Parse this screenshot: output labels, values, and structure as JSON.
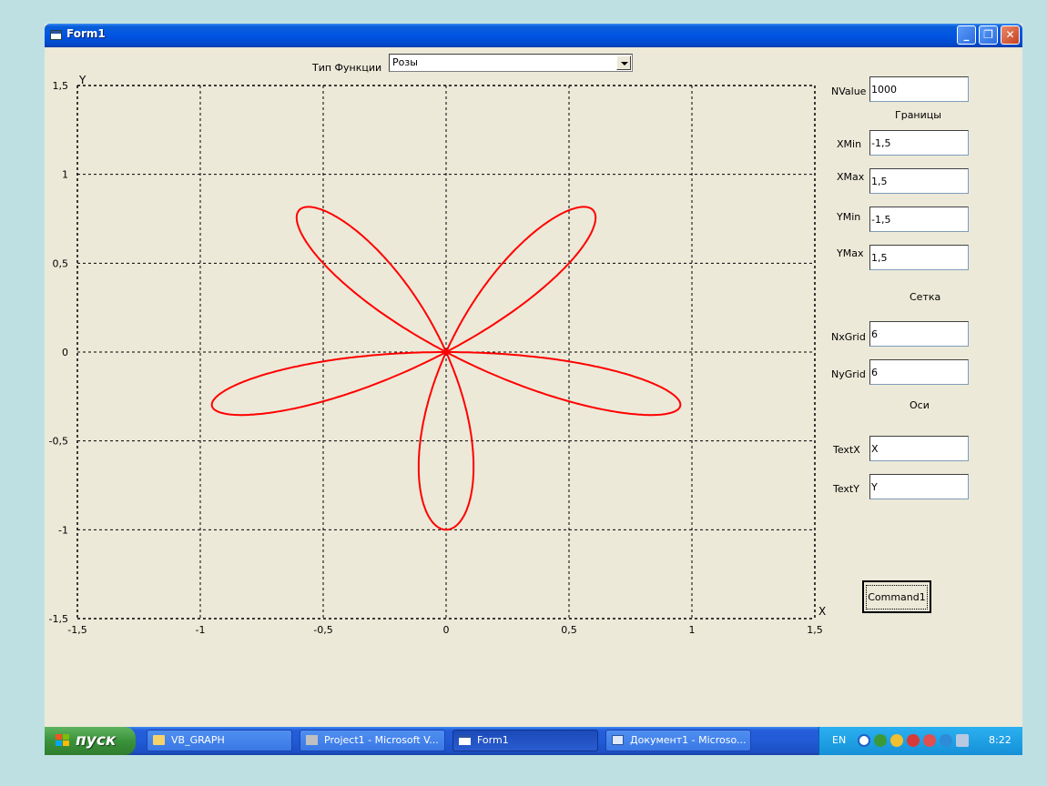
{
  "window": {
    "title": "Form1",
    "controls": {
      "minimize": "_",
      "restore": "❐",
      "close": "✕"
    }
  },
  "function_type": {
    "label": "Тип Функции",
    "value": "Розы"
  },
  "params": {
    "nvalue": {
      "label": "NValue",
      "value": "1000"
    },
    "bounds_heading": "Границы",
    "xmin": {
      "label": "XMin",
      "value": "-1,5"
    },
    "xmax": {
      "label": "XMax",
      "value": "1,5"
    },
    "ymin": {
      "label": "YMin",
      "value": "-1,5"
    },
    "ymax": {
      "label": "YMax",
      "value": "1,5"
    },
    "grid_heading": "Сетка",
    "nxgrid": {
      "label": "NxGrid",
      "value": "6"
    },
    "nygrid": {
      "label": "NyGrid",
      "value": "6"
    },
    "axes_heading": "Оси",
    "textx": {
      "label": "TextX",
      "value": "X"
    },
    "texty": {
      "label": "TextY",
      "value": "Y"
    },
    "command_label": "Command1"
  },
  "chart_data": {
    "type": "line",
    "curve": "rose",
    "equation": "r = cos(5θ)",
    "petals": 5,
    "xlim": [
      -1.5,
      1.5
    ],
    "ylim": [
      -1.5,
      1.5
    ],
    "x_ticks": [
      "-1,5",
      "-1",
      "-0,5",
      "0",
      "0,5",
      "1",
      "1,5"
    ],
    "y_ticks": [
      "1,5",
      "1",
      "0,5",
      "0",
      "-0,5",
      "-1",
      "-1,5"
    ],
    "xlabel": "X",
    "ylabel": "Y",
    "grid": true,
    "grid_divisions": 6,
    "line_color": "#ff0000",
    "samples": [
      {
        "x": 0,
        "y": -1
      },
      {
        "x": 0.951,
        "y": -0.309
      },
      {
        "x": 0.588,
        "y": 0.809
      },
      {
        "x": -0.588,
        "y": 0.809
      },
      {
        "x": -0.951,
        "y": -0.309
      }
    ]
  },
  "taskbar": {
    "start_label": "пуск",
    "tasks": [
      {
        "label": "VB_GRAPH"
      },
      {
        "label": "Project1 - Microsoft V..."
      },
      {
        "label": "Form1"
      },
      {
        "label": "Документ1 - Microso..."
      }
    ],
    "lang": "EN",
    "clock": "8:22"
  }
}
